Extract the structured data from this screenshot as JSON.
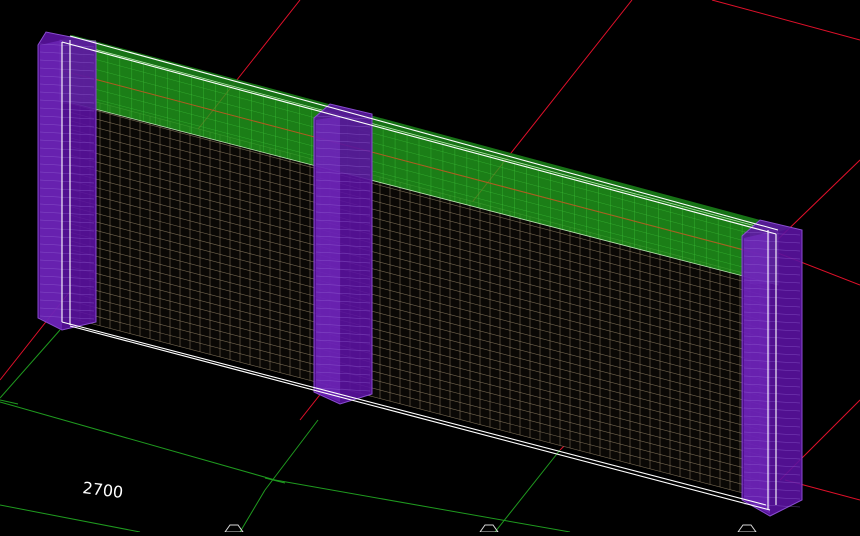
{
  "scene": {
    "dimension_label": "2700",
    "colors": {
      "background": "#000000",
      "axis_red": "#e0102a",
      "axis_green": "#1f9a1f",
      "beam_green": "#22a21e",
      "beam_cap": "#8fb8a6",
      "column_purple": "#5a12a0",
      "column_edge": "#8a4dd0",
      "mesh_line": "#8a7a60",
      "outline_white": "#ffffff",
      "rebar_red": "#c01818"
    }
  }
}
